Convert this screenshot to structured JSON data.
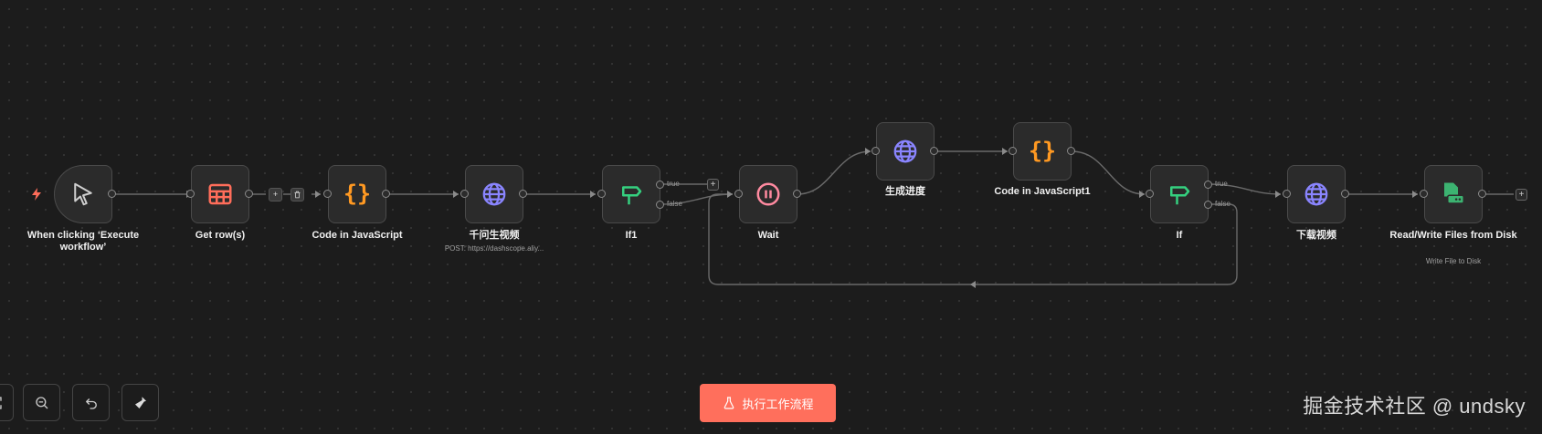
{
  "nodes": {
    "trigger": {
      "title": "When clicking ‘Execute workflow’"
    },
    "get_rows": {
      "title": "Get row(s)"
    },
    "code_js": {
      "title": "Code in JavaScript"
    },
    "qianwen": {
      "title": "千问生视频",
      "subtitle": "POST: https://dashscope.aliy..."
    },
    "if1": {
      "title": "If1",
      "true_label": "true",
      "false_label": "false"
    },
    "wait": {
      "title": "Wait"
    },
    "progress": {
      "title": "生成进度"
    },
    "code_js1": {
      "title": "Code in JavaScript1"
    },
    "if": {
      "title": "If",
      "true_label": "true",
      "false_label": "false"
    },
    "download": {
      "title": "下载视频"
    },
    "rw_files": {
      "title": "Read/Write Files from Disk",
      "subtitle": "Write File to Disk"
    }
  },
  "edge_buttons": {
    "add": "+",
    "delete": "🗑"
  },
  "controls": {
    "execute_label": "执行工作流程"
  },
  "watermark": "掘金技术社区 @ undsky",
  "colors": {
    "canvas": "#1c1c1c",
    "node_bg": "#2b2b2b",
    "table_icon": "#ff6d5a",
    "code_icon": "#ff9922",
    "globe_icon": "#8a85ff",
    "if_icon": "#35d07f",
    "wait_icon": "#ff8aa0",
    "file_icon": "#3cb371",
    "execute_button": "#ff6f5c"
  }
}
